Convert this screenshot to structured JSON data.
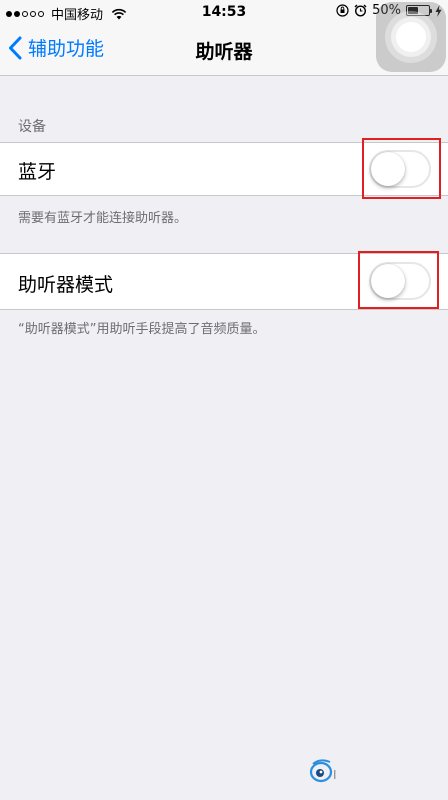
{
  "status_bar": {
    "carrier": "中国移动",
    "time": "14:53",
    "battery": "50%",
    "battery_level": 0.5,
    "signal_bars_filled": 2,
    "signal_bars_total": 5
  },
  "nav": {
    "back_label": "辅助功能",
    "title": "助听器"
  },
  "section": {
    "header": "设备"
  },
  "bluetooth": {
    "label": "蓝牙",
    "on": false,
    "footer": "需要有蓝牙才能连接助听器。"
  },
  "hearing_mode": {
    "label": "助听器模式",
    "on": false,
    "footer": "“助听器模式”用助听手段提高了音频质量。"
  },
  "colors": {
    "accent": "#007aff",
    "highlight": "#e02020",
    "background": "#efeff4"
  }
}
